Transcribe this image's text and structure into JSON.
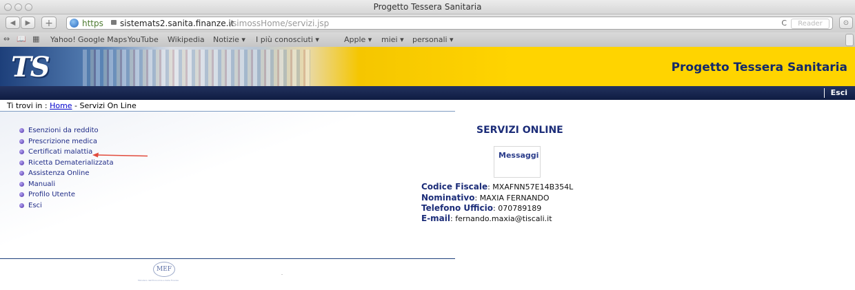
{
  "browser": {
    "window_title": "Progetto Tessera Sanitaria",
    "nav": {
      "back": "◀",
      "forward": "▶",
      "add": "+"
    },
    "url": {
      "scheme": "https",
      "host": "sistemats2.sanita.finanze.it",
      "path": "/simossHome/servizi.jsp"
    },
    "reload_icon": "C",
    "reader_label": "Reader",
    "bookmarks": [
      "Yahoo!",
      "Google Maps",
      "YouTube",
      "Wikipedia",
      "Notizie ▾",
      "I più conosciuti ▾",
      "Apple ▾",
      "miei ▾",
      "personali ▾"
    ]
  },
  "site": {
    "logo_text": "TS",
    "title": "Progetto Tessera Sanitaria",
    "nav_exit": "Esci",
    "breadcrumb": {
      "prefix": "Ti trovi in :",
      "home": "Home",
      "current": "- Servizi On Line"
    }
  },
  "menu": {
    "items": [
      "Esenzioni da reddito",
      "Prescrizione medica",
      "Certificati malattia",
      "Ricetta Dematerializzata",
      "Assistenza Online",
      "Manuali",
      "Profilo Utente",
      "Esci"
    ]
  },
  "main": {
    "title": "SERVIZI ONLINE",
    "messages_label": "Messaggi",
    "user": {
      "cf_label": "Codice Fiscale",
      "cf_value": ": MXAFNN57E14B354L",
      "name_label": "Nominativo",
      "name_value": ":  MAXIA FERNANDO",
      "phone_label": "Telefono Ufficio",
      "phone_value": ": 070789189",
      "email_label": "E-mail",
      "email_value": ": fernando.maxia@tiscali.it"
    }
  },
  "footer": {
    "logo_text": "MEF",
    "caption": "Ministero dell'Economia e delle Finanze"
  },
  "colors": {
    "brand_navy": "#13296a",
    "banner_yellow": "#ffd400",
    "link_blue": "#0000cc",
    "annotation_arrow": "#e24a3b"
  }
}
